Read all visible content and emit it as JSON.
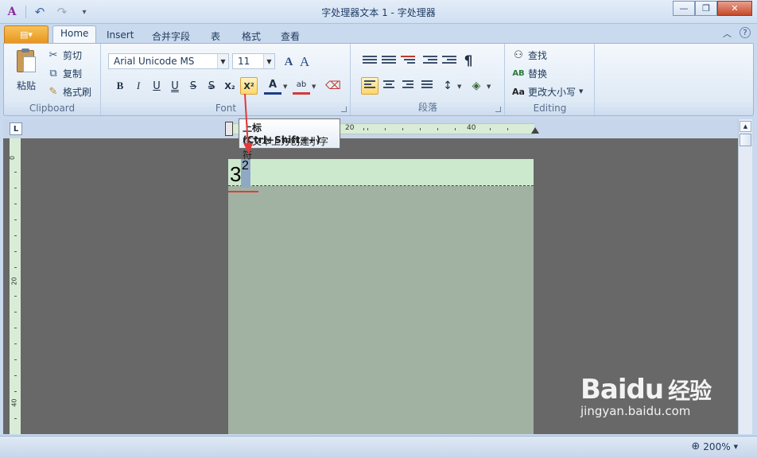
{
  "window": {
    "title": "字处理器文本 1 - 字处理器",
    "minimize": "—",
    "restore": "❐",
    "close": "✕"
  },
  "qat": {
    "app_icon": "A",
    "undo": "↶",
    "redo": "↷",
    "customize": "▾"
  },
  "tabs": [
    {
      "label": "Home",
      "active": true
    },
    {
      "label": "Insert"
    },
    {
      "label": "合并字段"
    },
    {
      "label": "表"
    },
    {
      "label": "格式"
    },
    {
      "label": "查看"
    }
  ],
  "file_menu_icon": "▤▾",
  "ribbon_right": {
    "collapse": "︿",
    "help": "?"
  },
  "clipboard": {
    "paste": "粘贴",
    "cut": "剪切",
    "copy": "复制",
    "format_painter": "格式刷",
    "group_label": "Clipboard"
  },
  "font": {
    "name": "Arial Unicode MS",
    "size": "11",
    "group_label": "Font",
    "bold": "B",
    "italic": "I",
    "underline": "U",
    "double_underline": "U",
    "strike": "S",
    "double_strike": "S",
    "subscript": "X₂",
    "superscript": "X²",
    "font_color": "A",
    "grow": "A",
    "shrink": "A",
    "highlight": "ab"
  },
  "paragraph": {
    "group_label": "段落",
    "pilcrow": "¶"
  },
  "editing": {
    "find": "查找",
    "replace": "替换",
    "change_case": "更改大小写",
    "change_case_icon": "Aa",
    "group_label": "Editing"
  },
  "tooltip": {
    "title": "上标 (Ctrl+Shift++)",
    "description": "在文本上方创建小字符"
  },
  "ruler": {
    "h_labels": [
      "20",
      "40"
    ],
    "v_labels": [
      "0",
      "20",
      "40"
    ],
    "tab_selector": "L"
  },
  "document": {
    "base_text": "3",
    "superscript_text": "2"
  },
  "status": {
    "zoom": "200%"
  },
  "watermark": {
    "logo_latin": "Baidu",
    "logo_cn": "经验",
    "url": "jingyan.baidu.com"
  },
  "colors": {
    "ribbon_bg": "#dfeaf6",
    "workspace": "#686868",
    "page": "#a2b2a2",
    "highlight_active": "#ffd667",
    "red_arrow": "#e23a3a"
  }
}
